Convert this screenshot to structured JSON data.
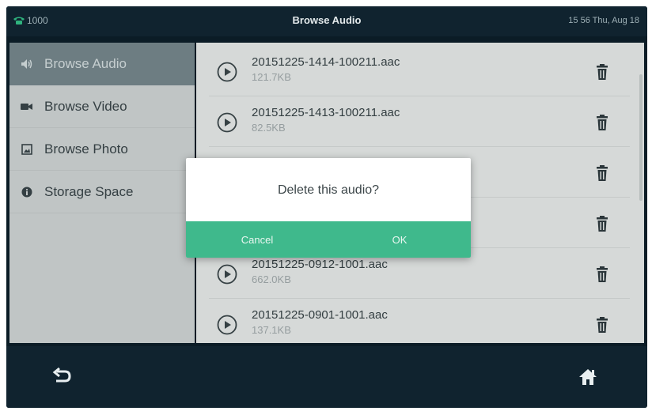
{
  "status": {
    "line": "1000",
    "title": "Browse Audio",
    "datetime": "15 56 Thu, Aug 18"
  },
  "sidebar": {
    "items": [
      {
        "label": "Browse Audio",
        "icon": "speaker-icon",
        "active": true
      },
      {
        "label": "Browse Video",
        "icon": "video-camera-icon",
        "active": false
      },
      {
        "label": "Browse Photo",
        "icon": "photo-icon",
        "active": false
      },
      {
        "label": "Storage Space",
        "icon": "info-icon",
        "active": false
      }
    ]
  },
  "files": [
    {
      "name": "20151225-1414-100211.aac",
      "size": "121.7KB"
    },
    {
      "name": "20151225-1413-100211.aac",
      "size": "82.5KB"
    },
    {
      "name": "",
      "size": ""
    },
    {
      "name": "",
      "size": ""
    },
    {
      "name": "20151225-0912-1001.aac",
      "size": "662.0KB"
    },
    {
      "name": "20151225-0901-1001.aac",
      "size": "137.1KB"
    }
  ],
  "dialog": {
    "message": "Delete this audio?",
    "cancel_label": "Cancel",
    "ok_label": "OK"
  },
  "colors": {
    "accent": "#3fb98c",
    "bar": "#10232f"
  }
}
